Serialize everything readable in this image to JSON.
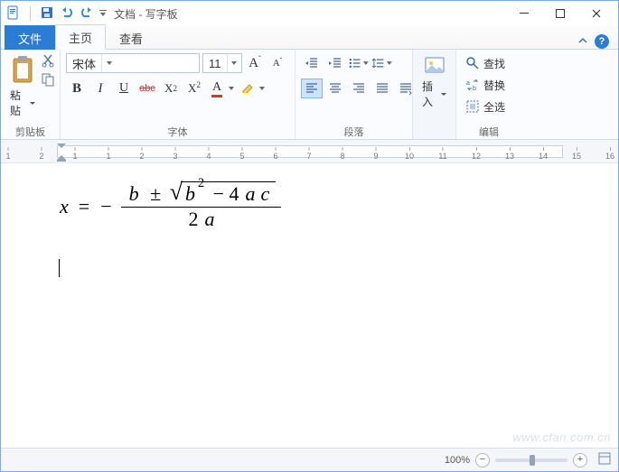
{
  "window": {
    "title": "文档 - 写字板"
  },
  "tabs": {
    "file": "文件",
    "home": "主页",
    "view": "查看"
  },
  "ribbon": {
    "clipboard": {
      "paste": "粘贴",
      "group": "剪贴板"
    },
    "font": {
      "name": "宋体",
      "size": "11",
      "grow": "A",
      "shrink": "A",
      "bold": "B",
      "italic": "I",
      "underline": "U",
      "strike": "abc",
      "subscript": "X₂",
      "superscript": "X²",
      "fontcolor": "A",
      "group": "字体"
    },
    "paragraph": {
      "group": "段落"
    },
    "insert": {
      "label": "插入",
      "group": ""
    },
    "edit": {
      "find": "查找",
      "replace": "替换",
      "selectall": "全选",
      "group": "编辑"
    }
  },
  "ruler": {
    "marks": [
      "1",
      "2",
      "1",
      "1",
      "2",
      "3",
      "4",
      "5",
      "6",
      "7",
      "8",
      "9",
      "10",
      "11",
      "12",
      "13",
      "14",
      "15",
      "16"
    ]
  },
  "document": {
    "eq": {
      "x": "x",
      "eq": "=",
      "minus": "−",
      "b": "b",
      "pm": "±",
      "b2": "b",
      "sq": "2",
      "m4": "− 4",
      "a": "a",
      "c": "c",
      "two": "2",
      "a2": "a"
    }
  },
  "status": {
    "zoom": "100%",
    "minus": "−",
    "plus": "+"
  },
  "watermark": "www.cfan.com.cn"
}
